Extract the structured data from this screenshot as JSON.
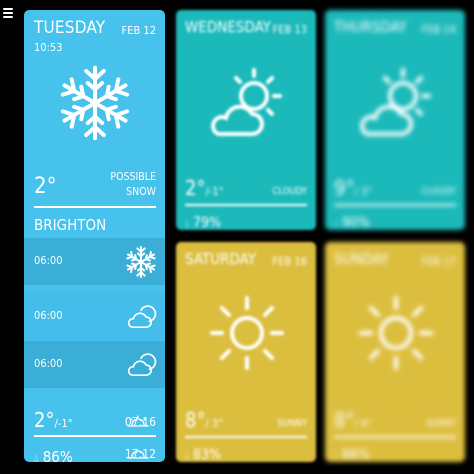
{
  "colors": {
    "today": "#47c2ec",
    "today_row": "#3aaed6",
    "cloudy": "#1bb9ba",
    "sunny": "#dcbe3f",
    "icon": "#ffffff"
  },
  "today": {
    "day": "TUESDAY",
    "date": "FEB 12",
    "time": "10:53",
    "icon": "snowflake-icon",
    "temp": "2°",
    "condition_line1": "POSSIBLE",
    "condition_line2": "SNOW",
    "city": "BRIGHTON",
    "hourly": [
      {
        "time": "06:00",
        "icon": "snowflake-icon"
      },
      {
        "time": "06:00",
        "icon": "cloud-moon-icon"
      },
      {
        "time": "06:00",
        "icon": "cloud-moon-icon"
      }
    ],
    "bottom_temp_high": "2°",
    "bottom_temp_low": "/-1°",
    "humidity": "86%",
    "sunrise": "07:16",
    "sunset": "17:12"
  },
  "forecast": [
    {
      "day": "WEDNESDAY",
      "date": "FEB 13",
      "icon": "sun-cloud-icon",
      "high": "2°",
      "low": "/-1°",
      "condition": "CLOUDY",
      "humidity": "79%"
    },
    {
      "day": "THURSDAY",
      "date": "FEB 14",
      "icon": "sun-cloud-icon",
      "high": "9°",
      "low": "/ 3°",
      "condition": "CLOUDY",
      "humidity": "90%"
    },
    {
      "day": "SATURDAY",
      "date": "FEB 16",
      "icon": "sun-icon",
      "high": "8°",
      "low": "/ 3°",
      "condition": "SUNNY",
      "humidity": "83%"
    },
    {
      "day": "SUNDAY",
      "date": "FEB 17",
      "icon": "sun-icon",
      "high": "8°",
      "low": "/ 4°",
      "condition": "SUNNY",
      "humidity": "86%"
    }
  ]
}
